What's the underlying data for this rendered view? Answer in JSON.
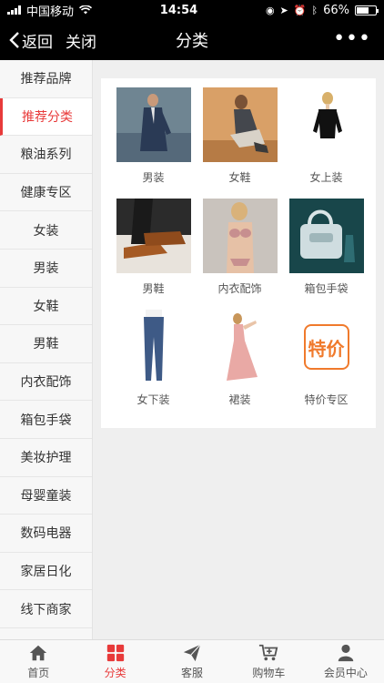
{
  "status": {
    "carrier": "中国移动",
    "time": "14:54",
    "battery": "66%",
    "battery_level": 0.66
  },
  "nav": {
    "back_label": "返回",
    "close_label": "关闭",
    "title": "分类",
    "more_label": "•••"
  },
  "sidebar": {
    "items": [
      {
        "label": "推荐品牌"
      },
      {
        "label": "推荐分类"
      },
      {
        "label": "粮油系列"
      },
      {
        "label": "健康专区"
      },
      {
        "label": "女装"
      },
      {
        "label": "男装"
      },
      {
        "label": "女鞋"
      },
      {
        "label": "男鞋"
      },
      {
        "label": "内衣配饰"
      },
      {
        "label": "箱包手袋"
      },
      {
        "label": "美妆护理"
      },
      {
        "label": "母婴童装"
      },
      {
        "label": "数码电器"
      },
      {
        "label": "家居日化"
      },
      {
        "label": "线下商家"
      }
    ],
    "active_index": 1
  },
  "categories": [
    {
      "label": "男装"
    },
    {
      "label": "女鞋"
    },
    {
      "label": "女上装"
    },
    {
      "label": "男鞋"
    },
    {
      "label": "内衣配饰"
    },
    {
      "label": "箱包手袋"
    },
    {
      "label": "女下装"
    },
    {
      "label": "裙装"
    },
    {
      "label": "特价专区",
      "badge": "特价"
    }
  ],
  "tabbar": {
    "items": [
      {
        "label": "首页",
        "icon": "home-icon"
      },
      {
        "label": "分类",
        "icon": "grid-icon"
      },
      {
        "label": "客服",
        "icon": "send-icon"
      },
      {
        "label": "购物车",
        "icon": "cart-icon"
      },
      {
        "label": "会员中心",
        "icon": "user-icon"
      }
    ]
  },
  "colors": {
    "accent": "#e83a3a",
    "badge": "#f07a2c"
  }
}
